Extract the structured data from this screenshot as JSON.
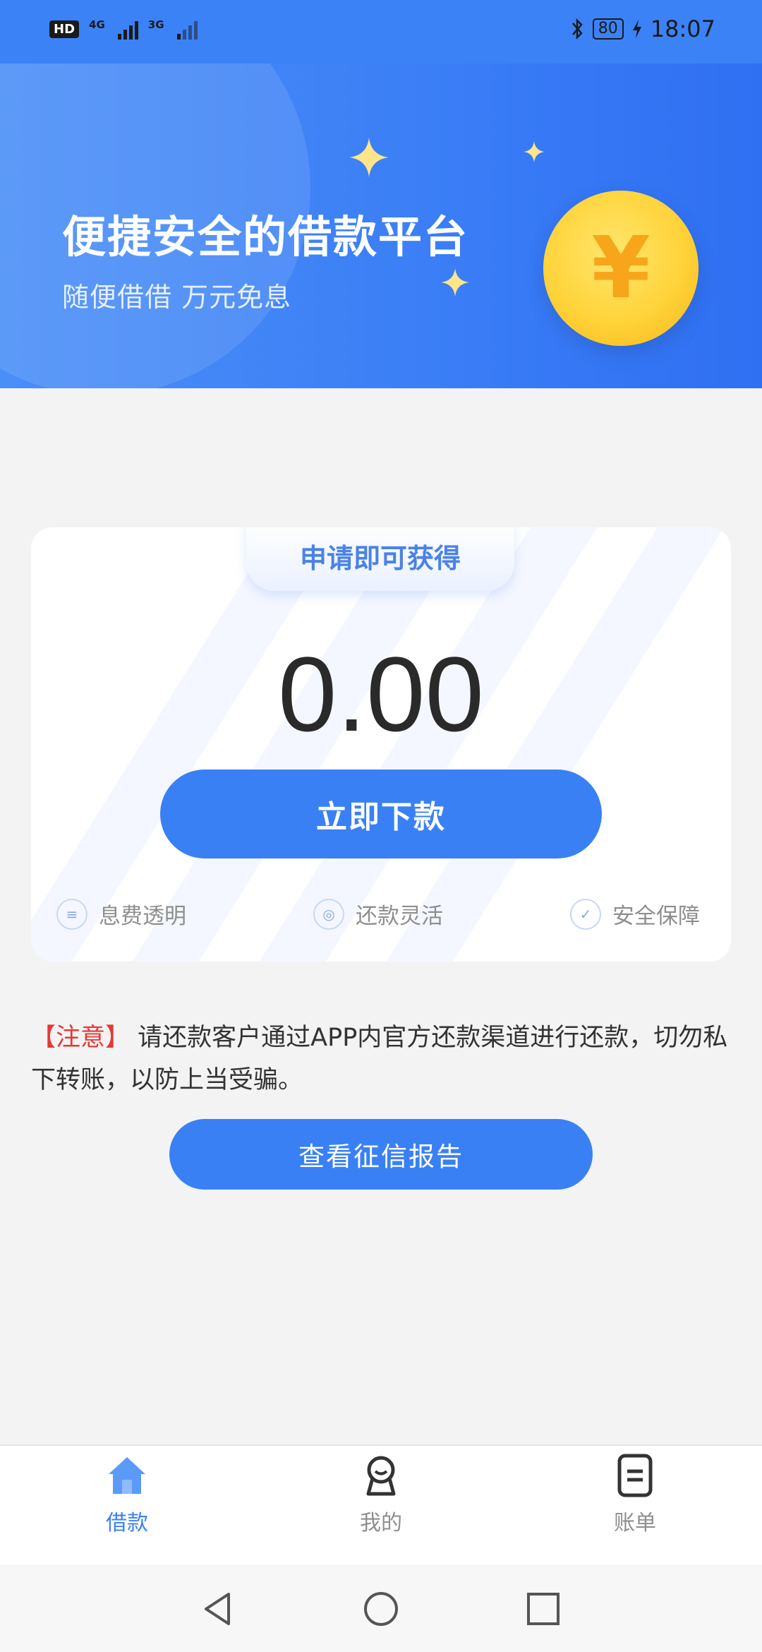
{
  "status_bar": {
    "hd_label": "HD",
    "sim1_label": "4G",
    "sim2_label": "3G",
    "battery": "80",
    "time": "18:07"
  },
  "hero": {
    "title": "便捷安全的借款平台",
    "subtitle": "随便借借 万元免息",
    "coin_symbol": "¥"
  },
  "card": {
    "tag": "申请即可获得",
    "amount": "0.00",
    "button_label": "立即下款",
    "features": [
      {
        "label": "息费透明",
        "icon": "list-icon"
      },
      {
        "label": "还款灵活",
        "icon": "target-icon"
      },
      {
        "label": "安全保障",
        "icon": "shield-icon"
      }
    ]
  },
  "notice": {
    "prefix": "【注意】",
    "text": " 请还款客户通过APP内官方还款渠道进行还款，切勿私下转账，以防上当受骗。"
  },
  "credit_button": "查看征信报告",
  "tabs": [
    {
      "label": "借款",
      "icon": "home-icon",
      "active": true
    },
    {
      "label": "我的",
      "icon": "profile-icon",
      "active": false
    },
    {
      "label": "账单",
      "icon": "bill-icon",
      "active": false
    }
  ],
  "colors": {
    "primary": "#3a80f5",
    "notice_red": "#e53935",
    "tab_active": "#3a80f5",
    "tab_inactive": "#8e8e8e"
  }
}
